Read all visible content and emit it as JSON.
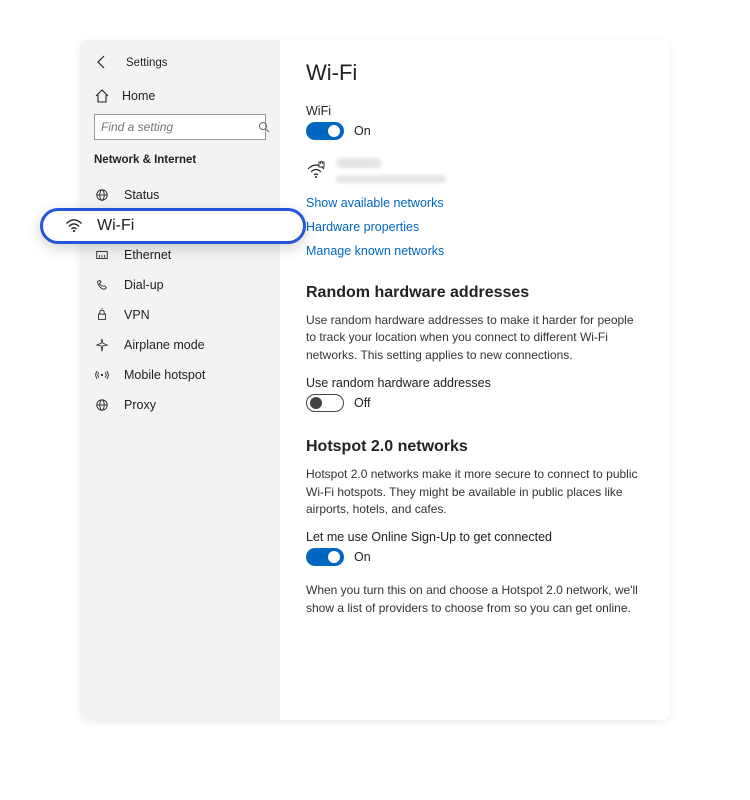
{
  "header": {
    "app_title": "Settings"
  },
  "sidebar": {
    "home_label": "Home",
    "search_placeholder": "Find a setting",
    "section_title": "Network & Internet",
    "items": [
      {
        "label": "Status"
      },
      {
        "label": "Wi-Fi"
      },
      {
        "label": "Ethernet"
      },
      {
        "label": "Dial-up"
      },
      {
        "label": "VPN"
      },
      {
        "label": "Airplane mode"
      },
      {
        "label": "Mobile hotspot"
      },
      {
        "label": "Proxy"
      }
    ]
  },
  "callout": {
    "label": "Wi-Fi"
  },
  "main": {
    "page_title": "Wi-Fi",
    "wifi_toggle": {
      "label": "WiFi",
      "state": "On"
    },
    "links": {
      "show_networks": "Show available networks",
      "hardware_props": "Hardware properties",
      "known_networks": "Manage known networks"
    },
    "random_hw": {
      "title": "Random hardware addresses",
      "desc": "Use random hardware addresses to make it harder for people to track your location when you connect to different Wi-Fi networks. This setting applies to new connections.",
      "toggle_label": "Use random hardware addresses",
      "state": "Off"
    },
    "hotspot": {
      "title": "Hotspot 2.0 networks",
      "desc": "Hotspot 2.0 networks make it more secure to connect to public Wi-Fi hotspots. They might be available in public places like airports, hotels, and cafes.",
      "toggle_label": "Let me use Online Sign-Up to get connected",
      "state": "On",
      "note": "When you turn this on and choose a Hotspot 2.0 network, we'll show a list of providers to choose from so you can get online."
    }
  }
}
